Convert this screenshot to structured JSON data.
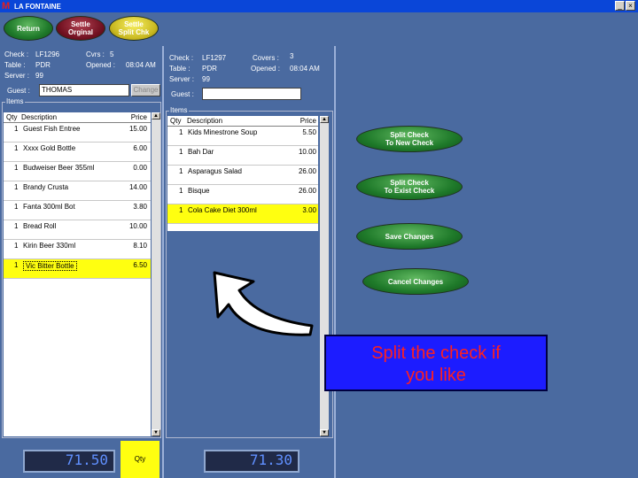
{
  "window": {
    "logo": "M",
    "title": "LA FONTAINE",
    "minimize_glyph": "_",
    "close_glyph": "×"
  },
  "toolbar": {
    "return_label": "Return",
    "settle_original_line1": "Settle",
    "settle_original_line2": "Orginal",
    "settle_split_line1": "Settle",
    "settle_split_line2": "Split Chk"
  },
  "left_check": {
    "check_label": "Check :",
    "check_value": "LF1296",
    "table_label": "Table :",
    "table_value": "PDR",
    "server_label": "Server :",
    "server_value": "99",
    "covers_label": "Cvrs :",
    "covers_value": "5",
    "opened_label": "Opened :",
    "opened_value": "08:04 AM",
    "guest_label": "Guest :",
    "guest_value": "THOMAS",
    "change_button": "Change",
    "items_label": "Items",
    "headers": {
      "qty": "Qty",
      "description": "Description",
      "price": "Price"
    },
    "rows": [
      {
        "qty": "1",
        "description": "Guest Fish Entree",
        "price": "15.00"
      },
      {
        "qty": "1",
        "description": "Xxxx Gold Bottle",
        "price": "6.00"
      },
      {
        "qty": "1",
        "description": "Budweiser Beer 355ml",
        "price": "0.00"
      },
      {
        "qty": "1",
        "description": "Brandy Crusta",
        "price": "14.00"
      },
      {
        "qty": "1",
        "description": "Fanta 300ml Bot",
        "price": "3.80"
      },
      {
        "qty": "1",
        "description": "Bread Roll",
        "price": "10.00"
      },
      {
        "qty": "1",
        "description": "Kirin Beer 330ml",
        "price": "8.10"
      },
      {
        "qty": "1",
        "description": "Vic Bitter Bottle",
        "price": "6.50"
      }
    ],
    "total": "71.50",
    "qty_button": "Qty"
  },
  "right_check": {
    "check_label": "Check :",
    "check_value": "LF1297",
    "table_label": "Table :",
    "table_value": "PDR",
    "server_label": "Server :",
    "server_value": "99",
    "covers_label": "Covers :",
    "covers_value": "3",
    "opened_label": "Opened :",
    "opened_value": "08:04 AM",
    "guest_label": "Guest :",
    "guest_value": "",
    "items_label": "Items",
    "headers": {
      "qty": "Qty",
      "description": "Description",
      "price": "Price"
    },
    "rows": [
      {
        "qty": "1",
        "description": "Kids Minestrone Soup",
        "price": "5.50"
      },
      {
        "qty": "1",
        "description": "Bah Dar",
        "price": "10.00"
      },
      {
        "qty": "1",
        "description": "Asparagus Salad",
        "price": "26.00"
      },
      {
        "qty": "1",
        "description": "Bisque",
        "price": "26.00"
      },
      {
        "qty": "1",
        "description": "Cola Cake Diet 300ml",
        "price": "3.00"
      }
    ],
    "total": "71.30"
  },
  "actions": {
    "split_new_line1": "Split Check",
    "split_new_line2": "To New Check",
    "split_existing_line1": "Split Check",
    "split_existing_line2": "To Exist Check",
    "save_changes": "Save Changes",
    "cancel_changes": "Cancel Changes"
  },
  "callout": {
    "line1": "Split the check if",
    "line2": "you like"
  },
  "colors": {
    "background": "#4a6aa0",
    "selected_row": "#ffff10",
    "callout_bg": "#1c1cff",
    "callout_text": "#ff2020",
    "button_green": "#1f7a2a"
  }
}
